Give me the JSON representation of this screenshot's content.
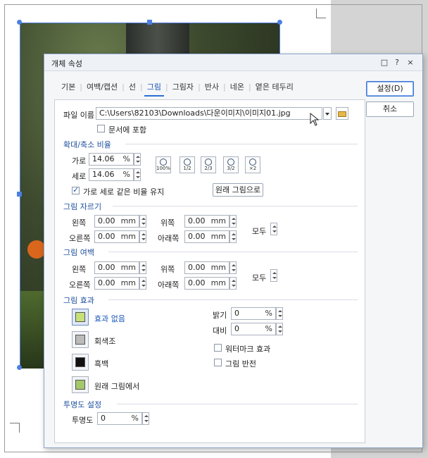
{
  "dialog": {
    "title": "개체 속성",
    "title_icons": [
      "□",
      "?",
      "×"
    ],
    "tabs": [
      "기본",
      "여백/캡션",
      "선",
      "그림",
      "그림자",
      "반사",
      "네온",
      "옅은 테두리"
    ],
    "active_tab": "그림",
    "ok_label": "설정(D)",
    "cancel_label": "취소"
  },
  "file": {
    "label": "파일 이름",
    "path": "C:\\Users\\82103\\Downloads\\다운이미지\\이미지01.jpg",
    "embed_label": "문서에 포함",
    "embed_checked": false
  },
  "scale": {
    "section": "확대/축소 비율",
    "width_label": "가로",
    "width_value": "14.06",
    "height_label": "세로",
    "height_value": "14.06",
    "unit": "%",
    "zoom_buttons": [
      "100%",
      "1/2",
      "2/3",
      "3/2",
      "×2"
    ],
    "keep_ratio_label": "가로 세로 같은 비율 유지",
    "keep_ratio_checked": true,
    "original_button": "원래 그림으로"
  },
  "crop": {
    "section": "그림 자르기",
    "left_label": "왼쪽",
    "left_value": "0.00",
    "top_label": "위쪽",
    "top_value": "0.00",
    "right_label": "오른쪽",
    "right_value": "0.00",
    "bottom_label": "아래쪽",
    "bottom_value": "0.00",
    "all_label": "모두",
    "unit": "mm"
  },
  "margin": {
    "section": "그림 여백",
    "left_label": "왼쪽",
    "left_value": "0.00",
    "top_label": "위쪽",
    "top_value": "0.00",
    "right_label": "오른쪽",
    "right_value": "0.00",
    "bottom_label": "아래쪽",
    "bottom_value": "0.00",
    "all_label": "모두",
    "unit": "mm"
  },
  "effect": {
    "section": "그림 효과",
    "none_label": "효과 없음",
    "gray_label": "회색조",
    "bw_label": "흑백",
    "original_label": "원래 그림에서",
    "brightness_label": "밝기",
    "brightness_value": "0",
    "contrast_label": "대비",
    "contrast_value": "0",
    "unit": "%",
    "watermark_label": "워터마크 효과",
    "invert_label": "그림 반전"
  },
  "transparency": {
    "section": "투명도 설정",
    "label": "투명도",
    "value": "0",
    "unit": "%"
  },
  "colors": {
    "accent": "#2b6fd6",
    "section_text": "#1f4f9e",
    "selection_handle": "#4c7fe0"
  }
}
